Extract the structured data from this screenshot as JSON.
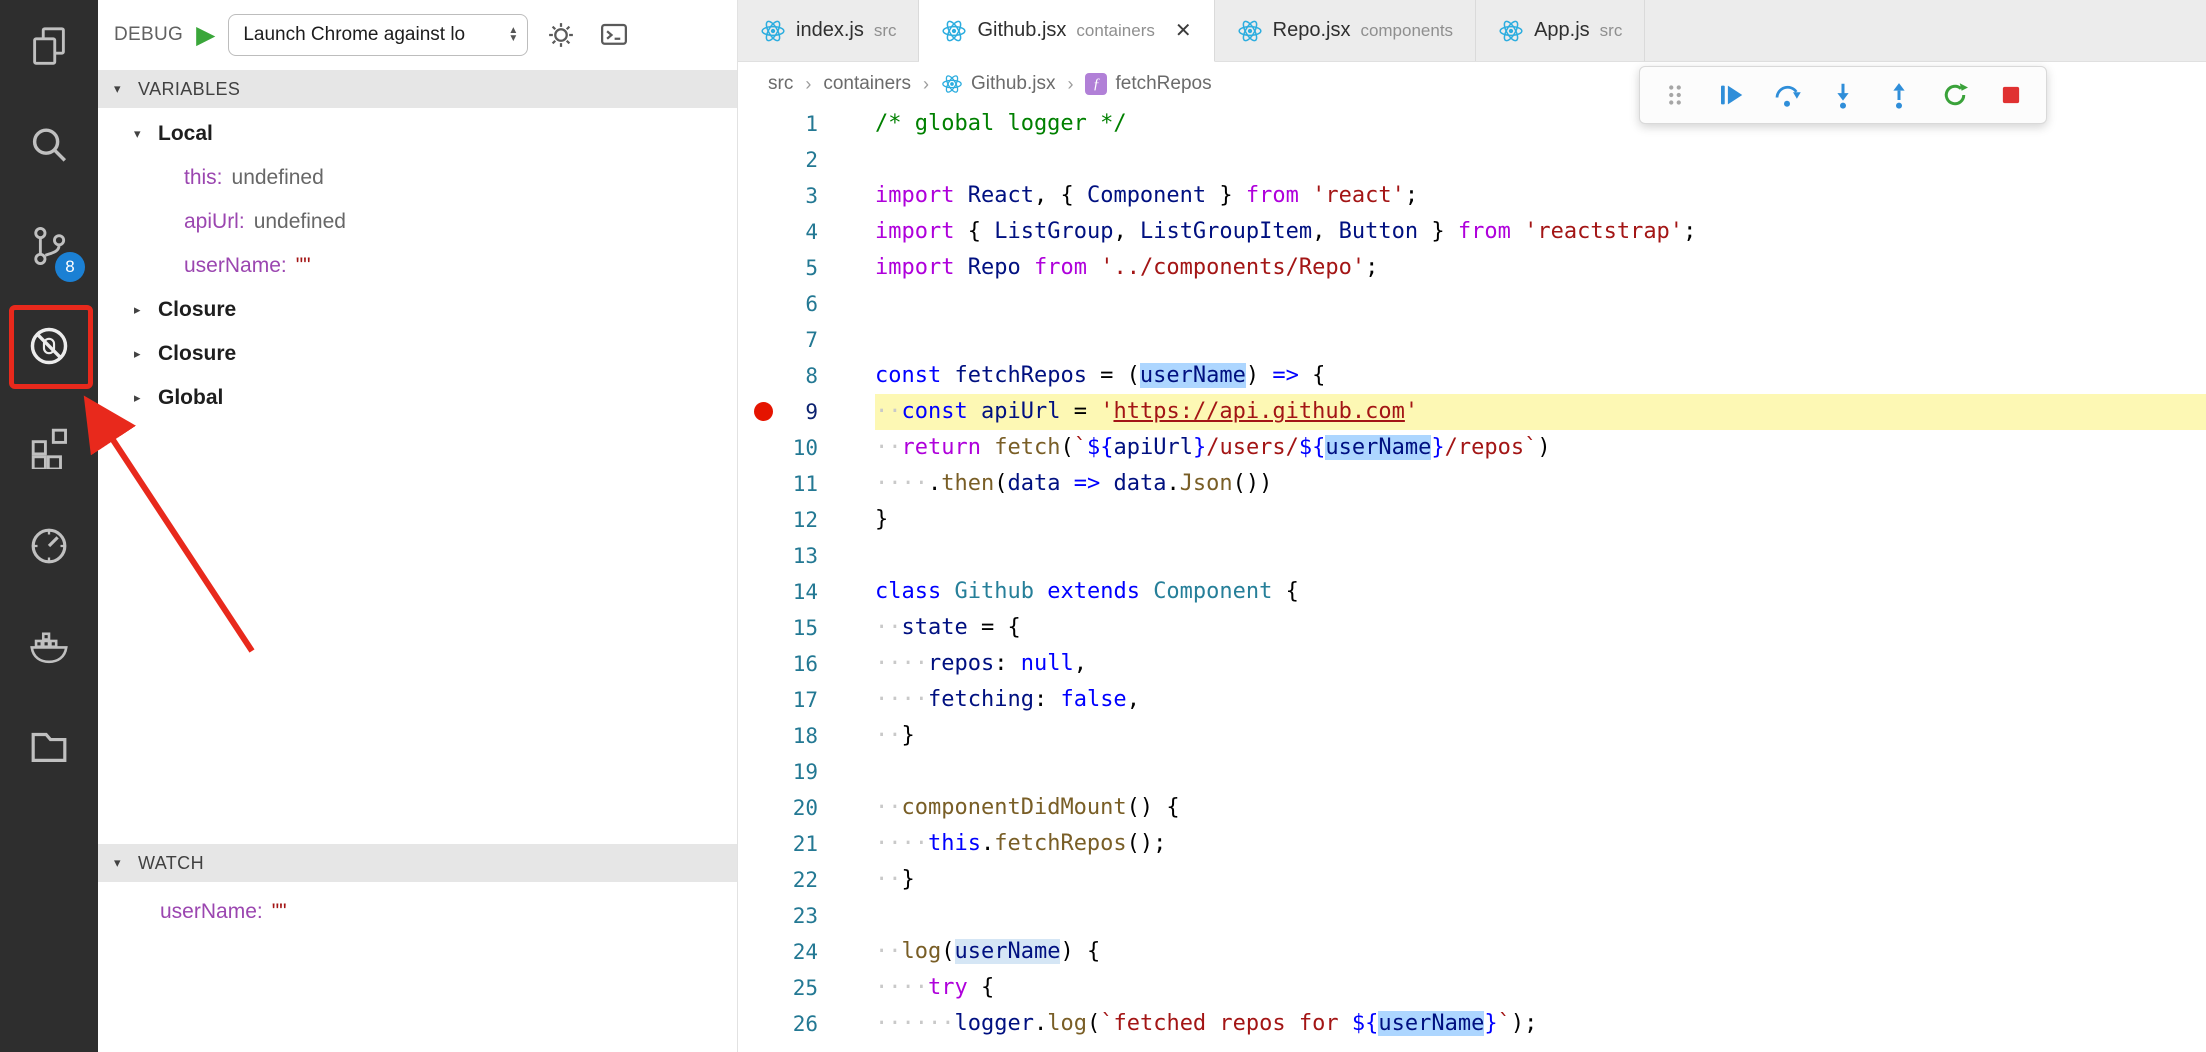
{
  "colors": {
    "accent": "#1b80d4",
    "annotation_red": "#e8291c",
    "breakpoint_red": "#e51400",
    "current_line_bg": "#fdf8b4",
    "selection_blue": "#add6ff",
    "activity_bar_bg": "#2e2e2e"
  },
  "activity_bar": {
    "items": [
      {
        "name": "explorer"
      },
      {
        "name": "search"
      },
      {
        "name": "source-control",
        "badge": "8"
      },
      {
        "name": "debug",
        "annotated": true
      },
      {
        "name": "extensions"
      },
      {
        "name": "gauge"
      },
      {
        "name": "docker"
      },
      {
        "name": "folder"
      }
    ]
  },
  "debug_panel": {
    "header": {
      "label": "DEBUG",
      "config": "Launch Chrome against lo"
    },
    "variables": {
      "title": "VARIABLES",
      "groups": [
        {
          "label": "Local",
          "expanded": true,
          "items": [
            {
              "name": "this",
              "value": "undefined",
              "kind": "undefined"
            },
            {
              "name": "apiUrl",
              "value": "undefined",
              "kind": "undefined"
            },
            {
              "name": "userName",
              "value": "\"\"",
              "kind": "string"
            }
          ]
        },
        {
          "label": "Closure",
          "expanded": false,
          "items": []
        },
        {
          "label": "Closure",
          "expanded": false,
          "items": []
        },
        {
          "label": "Global",
          "expanded": false,
          "items": []
        }
      ]
    },
    "watch": {
      "title": "WATCH",
      "items": [
        {
          "name": "userName",
          "value": "\"\"",
          "kind": "string"
        }
      ]
    }
  },
  "tabs": [
    {
      "label": "index.js",
      "dir": "src",
      "active": false
    },
    {
      "label": "Github.jsx",
      "dir": "containers",
      "active": true,
      "closable": true
    },
    {
      "label": "Repo.jsx",
      "dir": "components",
      "active": false
    },
    {
      "label": "App.js",
      "dir": "src",
      "active": false
    }
  ],
  "breadcrumb": [
    {
      "label": "src"
    },
    {
      "label": "containers"
    },
    {
      "label": "Github.jsx",
      "icon": "react"
    },
    {
      "label": "fetchRepos",
      "icon": "function"
    }
  ],
  "debug_toolbar": {
    "actions": [
      "drag-handle",
      "continue",
      "step-over",
      "step-into",
      "step-out",
      "restart",
      "stop"
    ]
  },
  "editor": {
    "file": "Github.jsx",
    "current_line": 9,
    "breakpoint_line": 9,
    "lines": [
      {
        "n": 1,
        "tokens": [
          [
            "cmt",
            "/* global logger */"
          ]
        ]
      },
      {
        "n": 2,
        "tokens": []
      },
      {
        "n": 3,
        "tokens": [
          [
            "ctrl",
            "import"
          ],
          [
            "pun",
            " "
          ],
          [
            "var",
            "React"
          ],
          [
            "pun",
            ", { "
          ],
          [
            "var",
            "Component"
          ],
          [
            "pun",
            " } "
          ],
          [
            "ctrl",
            "from"
          ],
          [
            "pun",
            " "
          ],
          [
            "str",
            "'react'"
          ],
          [
            "pun",
            ";"
          ]
        ]
      },
      {
        "n": 4,
        "tokens": [
          [
            "ctrl",
            "import"
          ],
          [
            "pun",
            " { "
          ],
          [
            "var",
            "ListGroup"
          ],
          [
            "pun",
            ", "
          ],
          [
            "var",
            "ListGroupItem"
          ],
          [
            "pun",
            ", "
          ],
          [
            "var",
            "Button"
          ],
          [
            "pun",
            " } "
          ],
          [
            "ctrl",
            "from"
          ],
          [
            "pun",
            " "
          ],
          [
            "str",
            "'reactstrap'"
          ],
          [
            "pun",
            ";"
          ]
        ]
      },
      {
        "n": 5,
        "tokens": [
          [
            "ctrl",
            "import"
          ],
          [
            "pun",
            " "
          ],
          [
            "var",
            "Repo"
          ],
          [
            "pun",
            " "
          ],
          [
            "ctrl",
            "from"
          ],
          [
            "pun",
            " "
          ],
          [
            "str",
            "'../components/Repo'"
          ],
          [
            "pun",
            ";"
          ]
        ]
      },
      {
        "n": 6,
        "tokens": []
      },
      {
        "n": 7,
        "tokens": []
      },
      {
        "n": 8,
        "tokens": [
          [
            "kw",
            "const"
          ],
          [
            "pun",
            " "
          ],
          [
            "var",
            "fetchRepos"
          ],
          [
            "pun",
            " = ("
          ],
          [
            "var sel",
            "userName"
          ],
          [
            "pun",
            ") "
          ],
          [
            "kw",
            "=>"
          ],
          [
            "pun",
            " {"
          ]
        ]
      },
      {
        "n": 9,
        "current": true,
        "breakpoint": true,
        "tokens": [
          [
            "ws",
            "··"
          ],
          [
            "kw",
            "const"
          ],
          [
            "pun",
            " "
          ],
          [
            "var",
            "apiUrl"
          ],
          [
            "pun",
            " = "
          ],
          [
            "str",
            "'"
          ],
          [
            "str link",
            "https://api.github.com"
          ],
          [
            "str",
            "'"
          ]
        ]
      },
      {
        "n": 10,
        "tokens": [
          [
            "ws",
            "··"
          ],
          [
            "ctrl",
            "return"
          ],
          [
            "pun",
            " "
          ],
          [
            "fn",
            "fetch"
          ],
          [
            "pun",
            "("
          ],
          [
            "str",
            "`"
          ],
          [
            "kw",
            "${"
          ],
          [
            "var",
            "apiUrl"
          ],
          [
            "kw",
            "}"
          ],
          [
            "str",
            "/users/"
          ],
          [
            "kw",
            "${"
          ],
          [
            "var sel",
            "userName"
          ],
          [
            "kw",
            "}"
          ],
          [
            "str",
            "/repos`"
          ],
          [
            "pun",
            ")"
          ]
        ]
      },
      {
        "n": 11,
        "tokens": [
          [
            "ws",
            "····"
          ],
          [
            "pun",
            "."
          ],
          [
            "fn",
            "then"
          ],
          [
            "pun",
            "("
          ],
          [
            "var",
            "data"
          ],
          [
            "pun",
            " "
          ],
          [
            "kw",
            "=>"
          ],
          [
            "pun",
            " "
          ],
          [
            "var",
            "data"
          ],
          [
            "pun",
            "."
          ],
          [
            "fn",
            "Json"
          ],
          [
            "pun",
            "())"
          ]
        ]
      },
      {
        "n": 12,
        "tokens": [
          [
            "pun",
            "}"
          ]
        ]
      },
      {
        "n": 13,
        "tokens": []
      },
      {
        "n": 14,
        "tokens": [
          [
            "kw",
            "class"
          ],
          [
            "pun",
            " "
          ],
          [
            "cls",
            "Github"
          ],
          [
            "pun",
            " "
          ],
          [
            "kw",
            "extends"
          ],
          [
            "pun",
            " "
          ],
          [
            "cls",
            "Component"
          ],
          [
            "pun",
            " {"
          ]
        ]
      },
      {
        "n": 15,
        "tokens": [
          [
            "ws",
            "··"
          ],
          [
            "var",
            "state"
          ],
          [
            "pun",
            " = {"
          ]
        ]
      },
      {
        "n": 16,
        "tokens": [
          [
            "ws",
            "····"
          ],
          [
            "var",
            "repos"
          ],
          [
            "pun",
            ": "
          ],
          [
            "kw",
            "null"
          ],
          [
            "pun",
            ","
          ]
        ]
      },
      {
        "n": 17,
        "tokens": [
          [
            "ws",
            "····"
          ],
          [
            "var",
            "fetching"
          ],
          [
            "pun",
            ": "
          ],
          [
            "kw",
            "false"
          ],
          [
            "pun",
            ","
          ]
        ]
      },
      {
        "n": 18,
        "tokens": [
          [
            "ws",
            "··"
          ],
          [
            "pun",
            "}"
          ]
        ]
      },
      {
        "n": 19,
        "tokens": []
      },
      {
        "n": 20,
        "tokens": [
          [
            "ws",
            "··"
          ],
          [
            "fn",
            "componentDidMount"
          ],
          [
            "pun",
            "() {"
          ]
        ]
      },
      {
        "n": 21,
        "tokens": [
          [
            "ws",
            "····"
          ],
          [
            "kw",
            "this"
          ],
          [
            "pun",
            "."
          ],
          [
            "fn",
            "fetchRepos"
          ],
          [
            "pun",
            "();"
          ]
        ]
      },
      {
        "n": 22,
        "tokens": [
          [
            "ws",
            "··"
          ],
          [
            "pun",
            "}"
          ]
        ]
      },
      {
        "n": 23,
        "tokens": []
      },
      {
        "n": 24,
        "tokens": [
          [
            "ws",
            "··"
          ],
          [
            "fn",
            "log"
          ],
          [
            "pun",
            "("
          ],
          [
            "var hl",
            "userName"
          ],
          [
            "pun",
            ") {"
          ]
        ]
      },
      {
        "n": 25,
        "tokens": [
          [
            "ws",
            "····"
          ],
          [
            "ctrl",
            "try"
          ],
          [
            "pun",
            " {"
          ]
        ]
      },
      {
        "n": 26,
        "tokens": [
          [
            "ws",
            "······"
          ],
          [
            "var",
            "logger"
          ],
          [
            "pun",
            "."
          ],
          [
            "fn",
            "log"
          ],
          [
            "pun",
            "("
          ],
          [
            "str",
            "`fetched repos for "
          ],
          [
            "kw",
            "${"
          ],
          [
            "var sel",
            "userName"
          ],
          [
            "kw",
            "}"
          ],
          [
            "str",
            "`"
          ],
          [
            "pun",
            ");"
          ]
        ]
      }
    ]
  }
}
